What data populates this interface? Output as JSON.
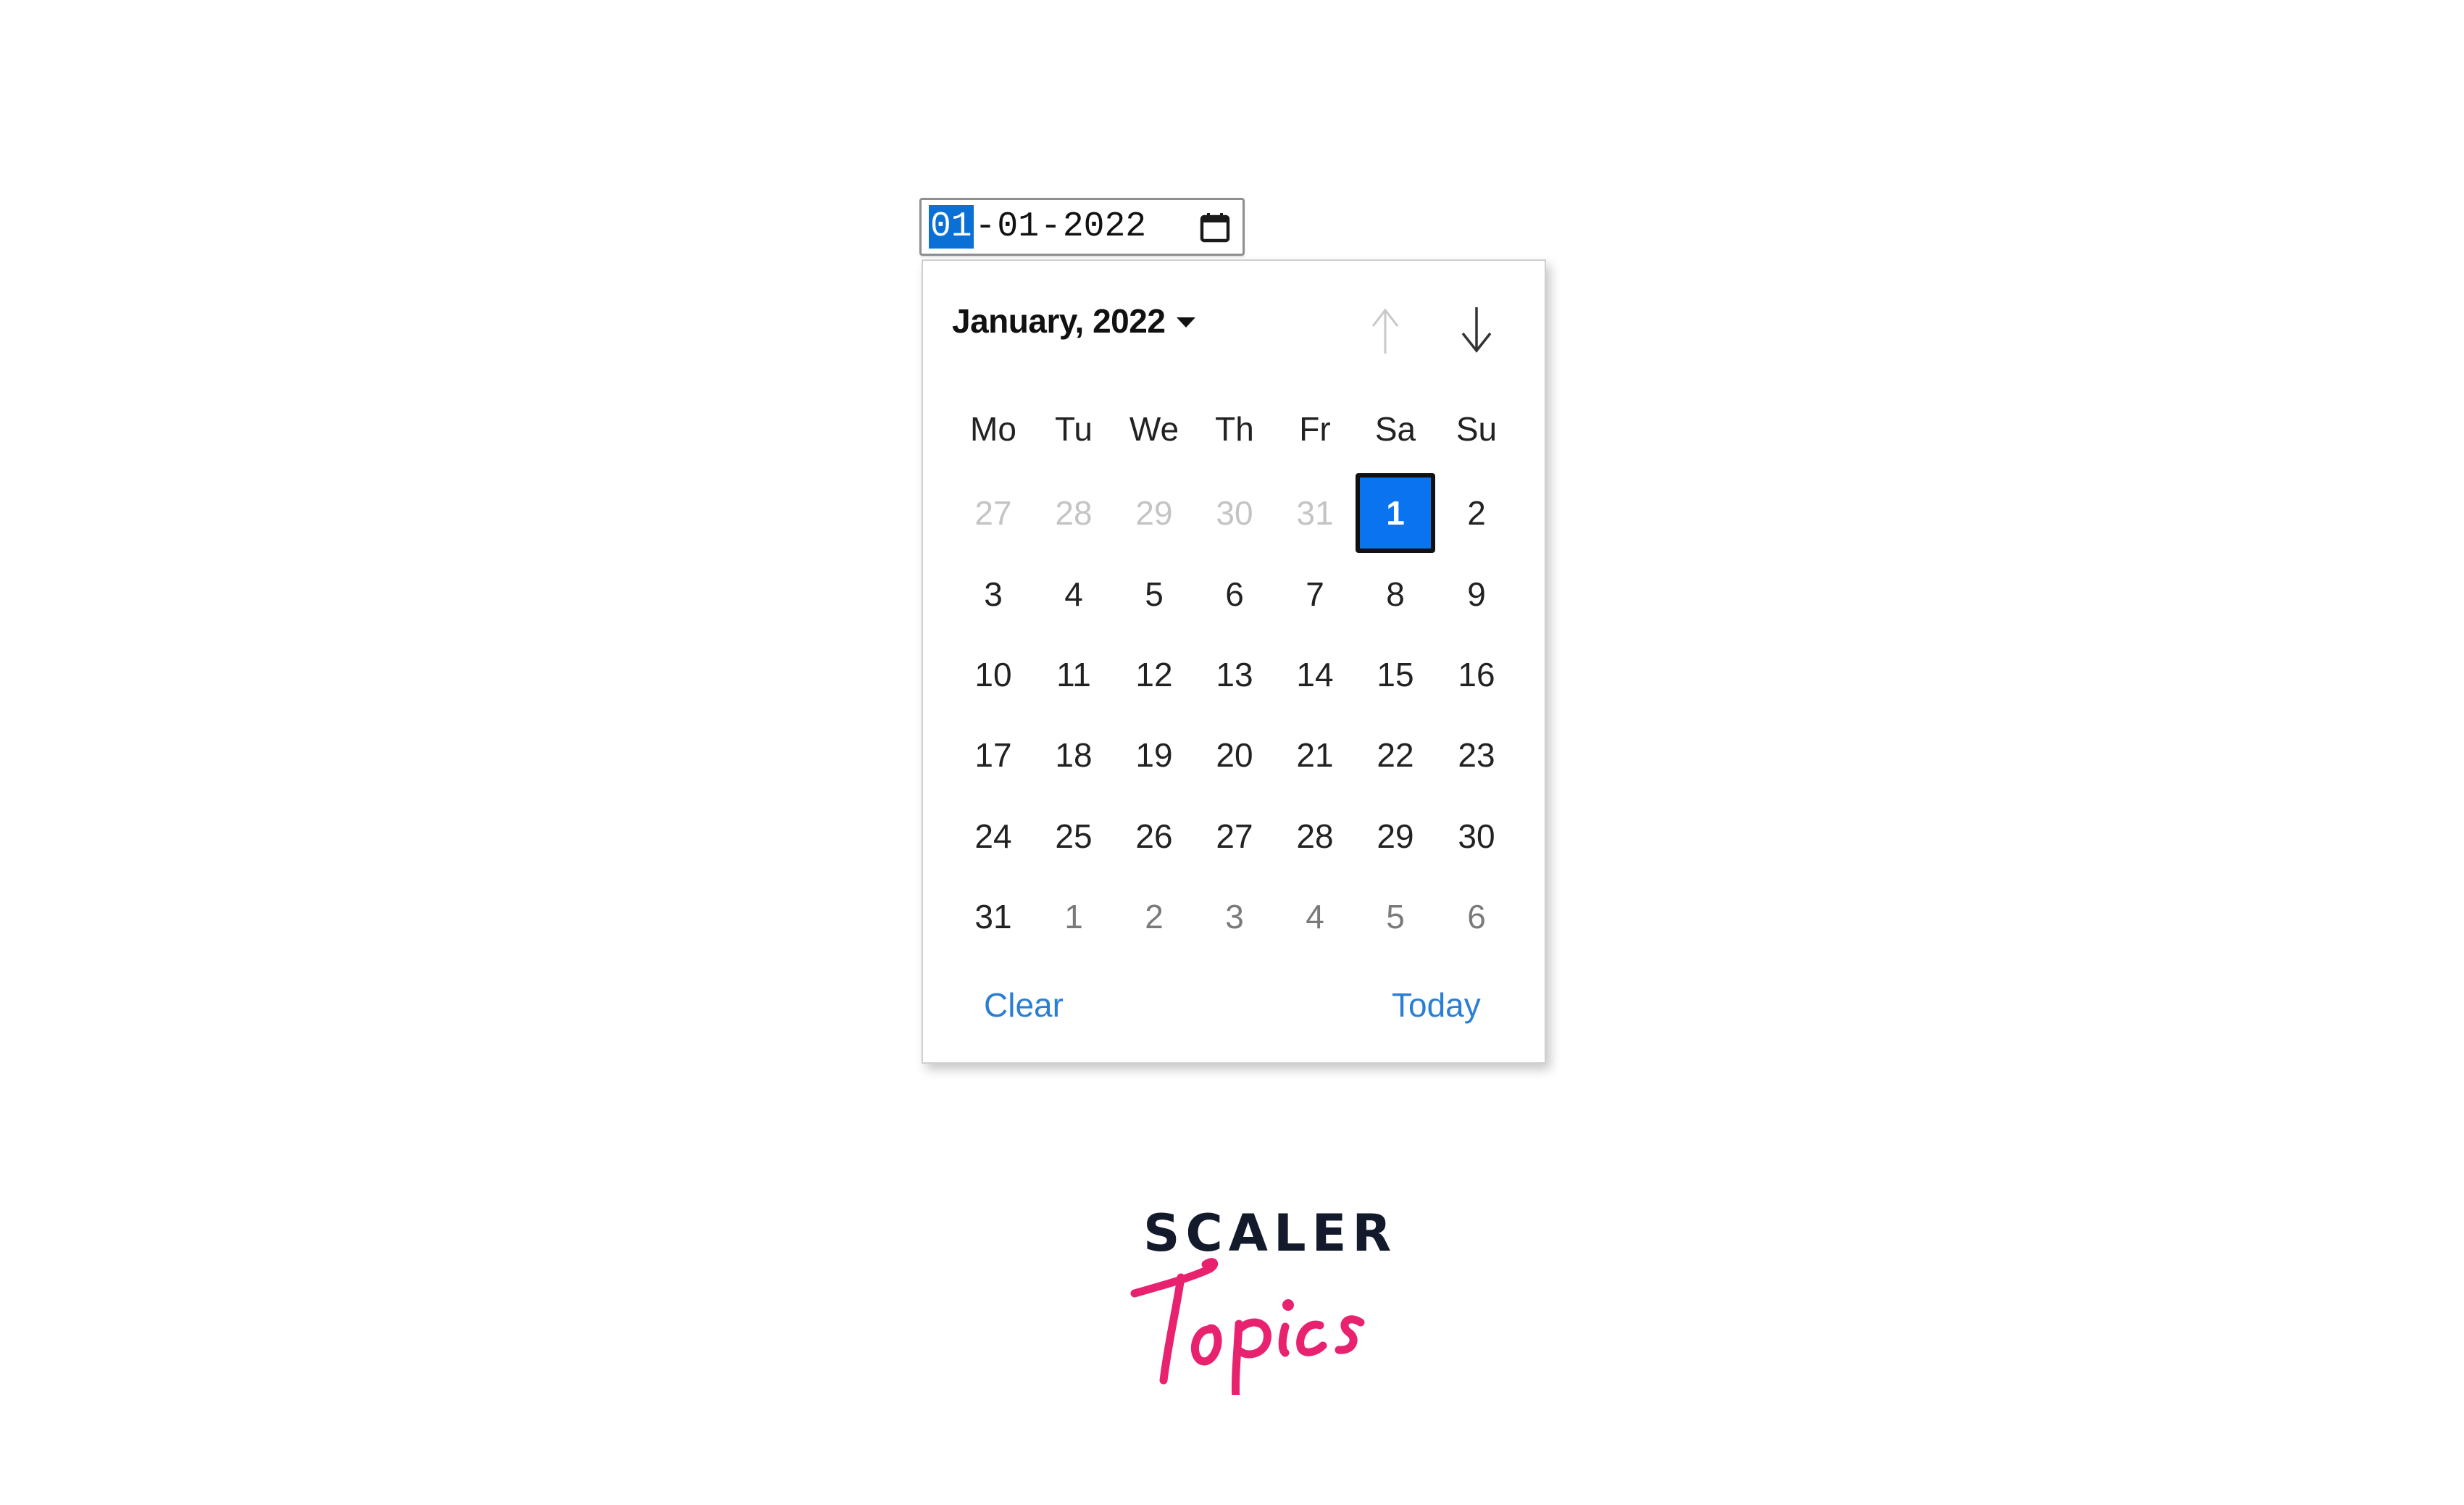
{
  "date_input": {
    "day": "01",
    "month": "01",
    "year": "2022",
    "separator": "-",
    "selected_segment": "day",
    "icon": "calendar-icon"
  },
  "calendar": {
    "month_label": "January, 2022",
    "dropdown_icon": "caret-down-icon",
    "prev_icon": "arrow-up-icon",
    "next_icon": "arrow-down-icon",
    "prev_disabled": true,
    "weekdays": [
      "Mo",
      "Tu",
      "We",
      "Th",
      "Fr",
      "Sa",
      "Su"
    ],
    "weeks": [
      [
        {
          "d": "27",
          "t": "prev"
        },
        {
          "d": "28",
          "t": "prev"
        },
        {
          "d": "29",
          "t": "prev"
        },
        {
          "d": "30",
          "t": "prev"
        },
        {
          "d": "31",
          "t": "prev"
        },
        {
          "d": "1",
          "t": "selected"
        },
        {
          "d": "2",
          "t": "cur"
        }
      ],
      [
        {
          "d": "3",
          "t": "cur"
        },
        {
          "d": "4",
          "t": "cur"
        },
        {
          "d": "5",
          "t": "cur"
        },
        {
          "d": "6",
          "t": "cur"
        },
        {
          "d": "7",
          "t": "cur"
        },
        {
          "d": "8",
          "t": "cur"
        },
        {
          "d": "9",
          "t": "cur"
        }
      ],
      [
        {
          "d": "10",
          "t": "cur"
        },
        {
          "d": "11",
          "t": "cur"
        },
        {
          "d": "12",
          "t": "cur"
        },
        {
          "d": "13",
          "t": "cur"
        },
        {
          "d": "14",
          "t": "cur"
        },
        {
          "d": "15",
          "t": "cur"
        },
        {
          "d": "16",
          "t": "cur"
        }
      ],
      [
        {
          "d": "17",
          "t": "cur"
        },
        {
          "d": "18",
          "t": "cur"
        },
        {
          "d": "19",
          "t": "cur"
        },
        {
          "d": "20",
          "t": "cur"
        },
        {
          "d": "21",
          "t": "cur"
        },
        {
          "d": "22",
          "t": "cur"
        },
        {
          "d": "23",
          "t": "cur"
        }
      ],
      [
        {
          "d": "24",
          "t": "cur"
        },
        {
          "d": "25",
          "t": "cur"
        },
        {
          "d": "26",
          "t": "cur"
        },
        {
          "d": "27",
          "t": "cur"
        },
        {
          "d": "28",
          "t": "cur"
        },
        {
          "d": "29",
          "t": "cur"
        },
        {
          "d": "30",
          "t": "cur"
        }
      ],
      [
        {
          "d": "31",
          "t": "cur"
        },
        {
          "d": "1",
          "t": "next"
        },
        {
          "d": "2",
          "t": "next"
        },
        {
          "d": "3",
          "t": "next"
        },
        {
          "d": "4",
          "t": "next"
        },
        {
          "d": "5",
          "t": "next"
        },
        {
          "d": "6",
          "t": "next"
        }
      ]
    ],
    "clear_label": "Clear",
    "today_label": "Today",
    "colors": {
      "selected_bg": "#0a74f0",
      "link": "#2a7fd4",
      "muted_prev": "#c4c4c4",
      "muted_next": "#7a7a7a"
    }
  },
  "branding": {
    "line1": "SCALER",
    "line2": "Topics",
    "line1_color": "#121a2b",
    "line2_color": "#e8226f"
  }
}
